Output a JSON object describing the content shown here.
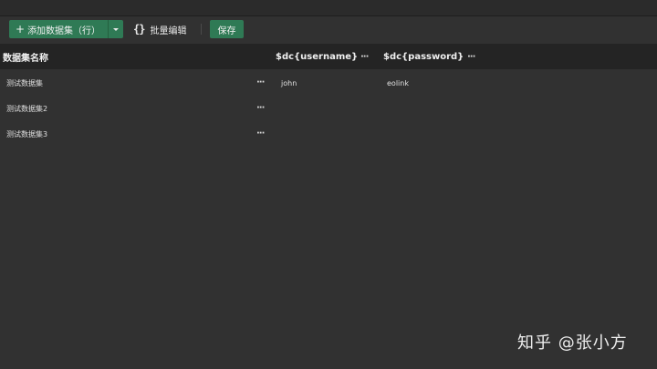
{
  "toolbar": {
    "add_button_label": "添加数据集（行）",
    "batch_edit_label": "批量编辑",
    "save_label": "保存"
  },
  "table": {
    "columns": [
      {
        "label": "数据集名称",
        "more": "···"
      },
      {
        "label": "$dc{username}",
        "more": "···"
      },
      {
        "label": "$dc{password}",
        "more": "···"
      }
    ],
    "rows": [
      {
        "name": "测试数据集",
        "more": "···",
        "username": "john",
        "password": "eolink"
      },
      {
        "name": "测试数据集2",
        "more": "···",
        "username": "",
        "password": ""
      },
      {
        "name": "测试数据集3",
        "more": "···",
        "username": "",
        "password": ""
      }
    ]
  },
  "watermark": "知乎 @张小方",
  "colors": {
    "background": "#313131",
    "header_background": "#242424",
    "accent_green": "#2f7a55"
  }
}
